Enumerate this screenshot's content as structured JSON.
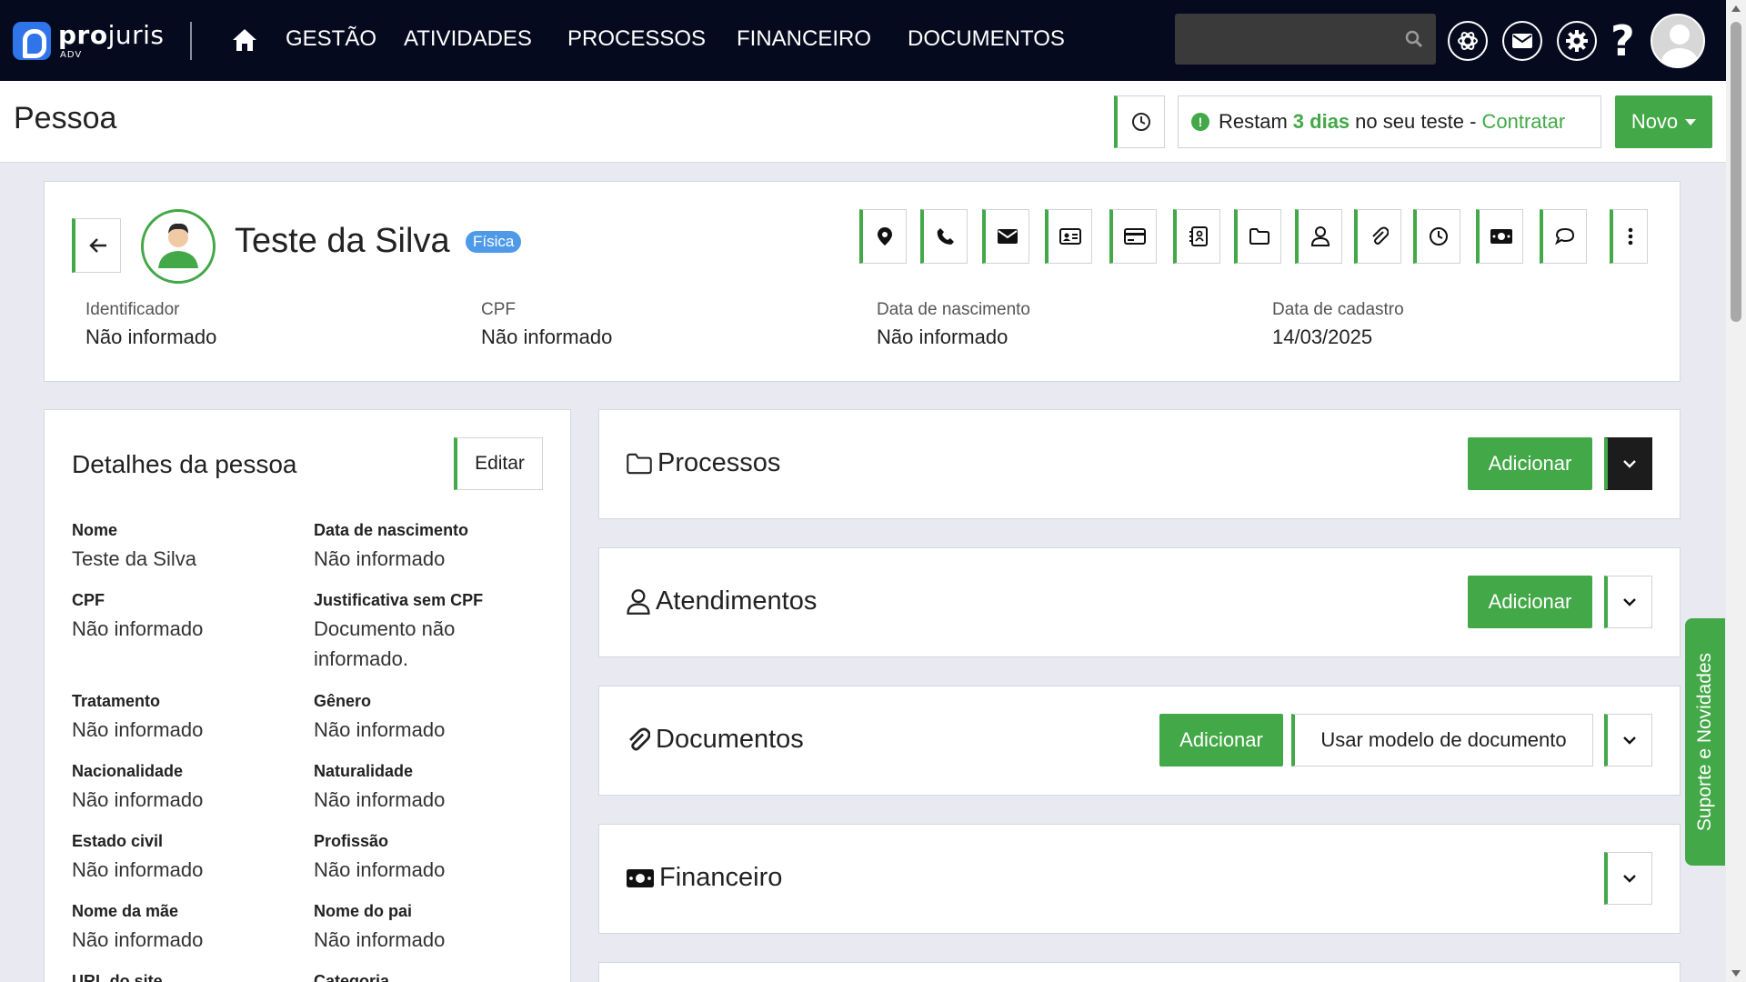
{
  "brand": {
    "name_bold": "pro",
    "name_rest": "juris",
    "sub": "ADV"
  },
  "nav": {
    "items": [
      "GESTÃO",
      "ATIVIDADES",
      "PROCESSOS",
      "FINANCEIRO",
      "DOCUMENTOS"
    ]
  },
  "header": {
    "title": "Pessoa",
    "trial_prefix": "Restam",
    "trial_days": "3 dias",
    "trial_suffix": "no seu teste -",
    "trial_link": "Contratar",
    "new_button": "Novo"
  },
  "person": {
    "name": "Teste da Silva",
    "type_badge": "Física",
    "fields": [
      {
        "label": "Identificador",
        "value": "Não informado"
      },
      {
        "label": "CPF",
        "value": "Não informado"
      },
      {
        "label": "Data de nascimento",
        "value": "Não informado"
      },
      {
        "label": "Data de cadastro",
        "value": "14/03/2025"
      }
    ],
    "toolbar_icons": [
      "location-icon",
      "phone-icon",
      "mail-icon",
      "id-card-icon",
      "credit-card-icon",
      "contacts-icon",
      "folder-icon",
      "user-icon",
      "paperclip-icon",
      "clock-icon",
      "money-icon",
      "chat-icon",
      "more-icon"
    ]
  },
  "details": {
    "title": "Detalhes da pessoa",
    "edit_label": "Editar",
    "rows": [
      [
        {
          "label": "Nome",
          "value": "Teste da Silva"
        },
        {
          "label": "Data de nascimento",
          "value": "Não informado"
        }
      ],
      [
        {
          "label": "CPF",
          "value": "Não informado"
        },
        {
          "label": "Justificativa sem CPF",
          "value": "Documento não informado."
        }
      ],
      [
        {
          "label": "Tratamento",
          "value": "Não informado"
        },
        {
          "label": "Gênero",
          "value": "Não informado"
        }
      ],
      [
        {
          "label": "Nacionalidade",
          "value": "Não informado"
        },
        {
          "label": "Naturalidade",
          "value": "Não informado"
        }
      ],
      [
        {
          "label": "Estado civil",
          "value": "Não informado"
        },
        {
          "label": "Profissão",
          "value": "Não informado"
        }
      ],
      [
        {
          "label": "Nome da mãe",
          "value": "Não informado"
        },
        {
          "label": "Nome do pai",
          "value": "Não informado"
        }
      ],
      [
        {
          "label": "URL do site",
          "value": ""
        },
        {
          "label": "Categoria",
          "value": ""
        }
      ]
    ]
  },
  "sections": [
    {
      "title": "Processos",
      "add_label": "Adicionar"
    },
    {
      "title": "Atendimentos",
      "add_label": "Adicionar"
    },
    {
      "title": "Documentos",
      "add_label": "Adicionar",
      "template_label": "Usar modelo de documento"
    },
    {
      "title": "Financeiro"
    }
  ],
  "support_tab": "Suporte e Novidades",
  "colors": {
    "accent": "#43a847",
    "nav_bg": "#050a1e",
    "badge": "#4f9ae8"
  }
}
